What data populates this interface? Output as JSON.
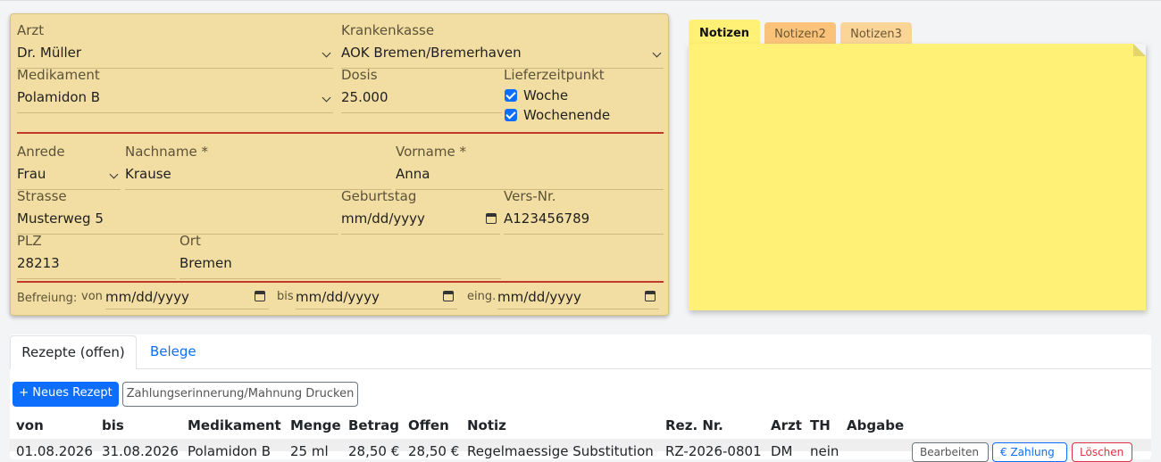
{
  "patient": {
    "arzt": {
      "label": "Arzt",
      "value": "Dr. Müller"
    },
    "krankenkasse": {
      "label": "Krankenkasse",
      "value": "AOK Bremen/Bremerhaven"
    },
    "medikament": {
      "label": "Medikament",
      "value": "Polamidon B"
    },
    "dosis": {
      "label": "Dosis",
      "value": "25.000"
    },
    "lieferzeitpunkt": {
      "label": "Lieferzeitpunkt",
      "woche": "Woche",
      "wochenende": "Wochenende",
      "woche_checked": true,
      "wochenende_checked": true
    },
    "anrede": {
      "label": "Anrede",
      "value": "Frau"
    },
    "nachname": {
      "label": "Nachname *",
      "value": "Krause"
    },
    "vorname": {
      "label": "Vorname *",
      "value": "Anna"
    },
    "strasse": {
      "label": "Strasse",
      "value": "Musterweg 5"
    },
    "geburtstag": {
      "label": "Geburtstag",
      "placeholder": "mm/dd/yyyy"
    },
    "versnr": {
      "label": "Vers-Nr.",
      "value": "A123456789"
    },
    "plz": {
      "label": "PLZ",
      "value": "28213"
    },
    "ort": {
      "label": "Ort",
      "value": "Bremen"
    },
    "befreiung": {
      "label": "Befreiung:",
      "von_label": "von",
      "bis_label": "bis",
      "eing_label": "eing.",
      "von_placeholder": "mm/dd/yyyy",
      "bis_placeholder": "mm/dd/yyyy",
      "eing_placeholder": "mm/dd/yyyy"
    }
  },
  "notes": {
    "tabs": [
      "Notizen",
      "Notizen2",
      "Notizen3"
    ],
    "active_tab": "Notizen",
    "color": "#fff176"
  },
  "main_tabs": {
    "rezepte": "Rezepte (offen)",
    "belege": "Belege"
  },
  "actions": {
    "new_recipe": "+ Neues Rezept",
    "print_reminder": "Zahlungserinnerung/Mahnung Drucken"
  },
  "table": {
    "headers": [
      "von",
      "bis",
      "Medikament",
      "Menge",
      "Betrag",
      "Offen",
      "Notiz",
      "Rez. Nr.",
      "Arzt",
      "TH",
      "Abgabe"
    ],
    "rows": [
      {
        "von": "01.08.2026",
        "bis": "31.08.2026",
        "medikament": "Polamidon B",
        "menge": "25 ml",
        "betrag": "28,50 €",
        "offen": "28,50 €",
        "notiz": "Regelmaessige Substitution",
        "reznr": "RZ-2026-0801",
        "arzt": "DM",
        "th": "nein",
        "abgabe": "",
        "btn_edit": "Bearbeiten",
        "btn_pay": "€ Zahlung",
        "btn_delete": "Löschen"
      }
    ]
  },
  "colors": {
    "card_bg": "#f2dea3",
    "accent_red": "#c0392b",
    "primary": "#0d6efd",
    "note_yellow": "#fff176"
  }
}
